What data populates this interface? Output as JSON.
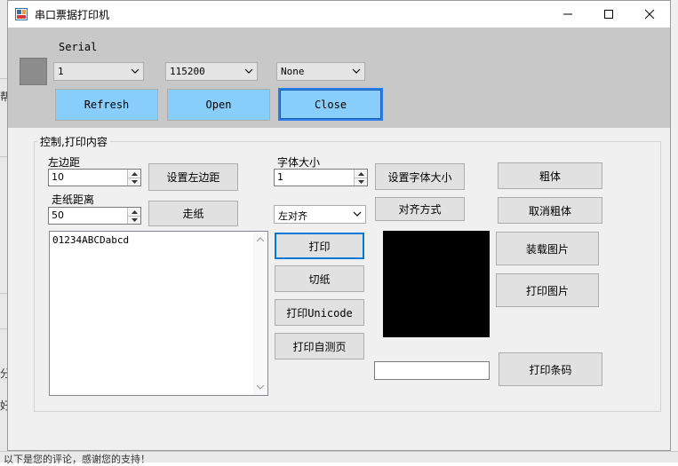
{
  "window": {
    "title": "串口票据打印机",
    "controls": {
      "minimize": "—",
      "maximize": "☐",
      "close": "✕"
    }
  },
  "background": {
    "fragments": [
      "帮",
      "分",
      "好",
      "以下是您的评论，感谢您的支持！"
    ]
  },
  "serial": {
    "label": "Serial",
    "port": {
      "value": "1"
    },
    "baud": {
      "value": "115200"
    },
    "parity": {
      "value": "None"
    },
    "refresh_label": "Refresh",
    "open_label": "Open",
    "close_label": "Close",
    "status_color": "#8c8c8c"
  },
  "control": {
    "group_title": "控制,打印内容",
    "left_margin": {
      "label": "左边距",
      "value": "10",
      "button": "设置左边距"
    },
    "feed": {
      "label": "走纸距离",
      "value": "50",
      "button": "走纸"
    },
    "font_size": {
      "label": "字体大小",
      "value": "1",
      "button": "设置字体大小"
    },
    "align": {
      "value": "左对齐",
      "button": "对齐方式"
    },
    "content": "01234ABCDabcd",
    "print_label": "打印",
    "cut_label": "切纸",
    "print_unicode_label": "打印Unicode",
    "self_test_label": "打印自测页",
    "bold_label": "粗体",
    "cancel_bold_label": "取消粗体",
    "load_image_label": "装载图片",
    "print_image_label": "打印图片",
    "barcode_value": "",
    "print_barcode_label": "打印条码"
  },
  "colors": {
    "accent_blue": "#87cefa",
    "panel_gray": "#c8c8c8",
    "image_preview": "#000000"
  }
}
